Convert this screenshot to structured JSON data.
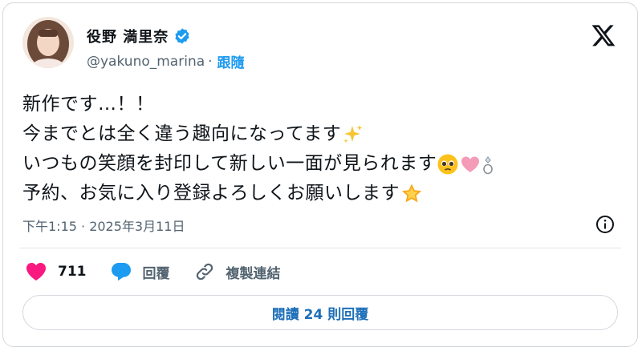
{
  "author": {
    "display_name": "役野 満里奈",
    "handle": "@yakuno_marina",
    "separator": "·",
    "follow_label": "跟隨",
    "verified": true
  },
  "tweet": {
    "lines": [
      "新作です…！！",
      "今までとは全く違う趣向になってます",
      "いつもの笑顔を封印して新しい一面が見られます",
      "予約、お気に入り登録よろしくお願いします"
    ],
    "emoji": {
      "line2": "sparkles-icon",
      "line3": [
        "pleading-face-icon",
        "pink-heart-icon",
        "ring-icon"
      ],
      "line4": "glowing-star-icon"
    }
  },
  "timestamp": "下午1:15 · 2025年3月11日",
  "actions": {
    "like_count": "711",
    "reply_label": "回覆",
    "copy_link_label": "複製連結"
  },
  "read_replies_label": "閱讀 24 則回覆",
  "colors": {
    "accent": "#1d9bf0",
    "like": "#f91880",
    "text": "#0f1419",
    "secondary": "#536471"
  }
}
